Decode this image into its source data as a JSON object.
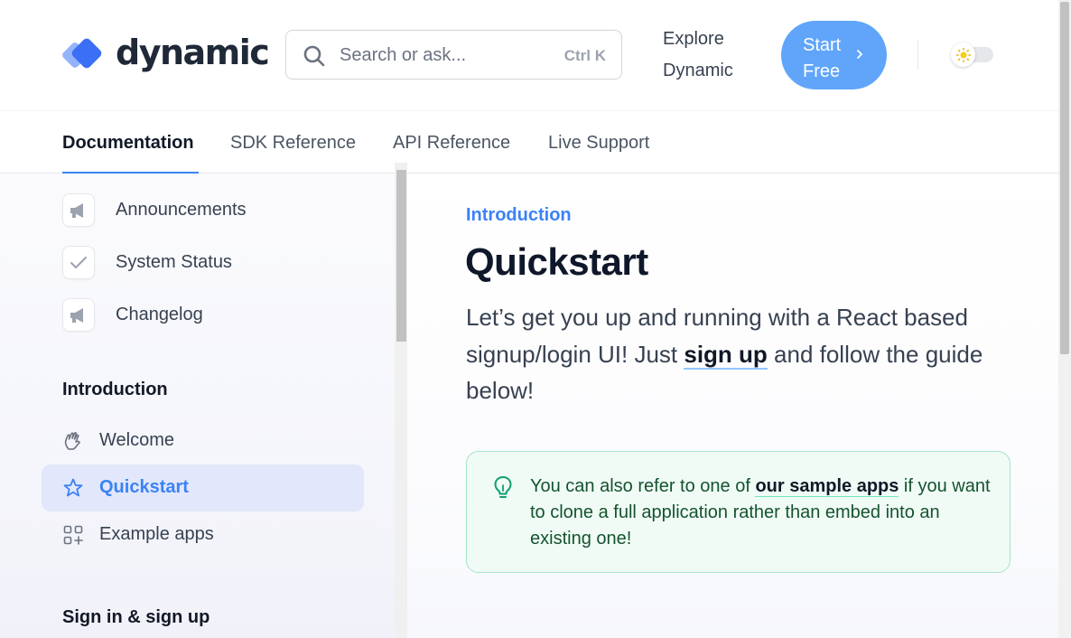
{
  "header": {
    "brand": "dynamic",
    "search_placeholder": "Search or ask...",
    "search_shortcut": "Ctrl K",
    "explore_label": "Explore Dynamic",
    "cta_label": "Start Free",
    "accent_color": "#60a5fa"
  },
  "tabs": [
    {
      "label": "Documentation",
      "active": true
    },
    {
      "label": "SDK Reference",
      "active": false
    },
    {
      "label": "API Reference",
      "active": false
    },
    {
      "label": "Live Support",
      "active": false
    }
  ],
  "sidebar": {
    "links": [
      {
        "label": "Announcements",
        "icon": "megaphone-icon"
      },
      {
        "label": "System Status",
        "icon": "check-icon"
      },
      {
        "label": "Changelog",
        "icon": "megaphone-icon"
      }
    ],
    "sections": [
      {
        "title": "Introduction",
        "items": [
          {
            "label": "Welcome",
            "icon": "waving-hand-icon",
            "active": false
          },
          {
            "label": "Quickstart",
            "icon": "star-icon",
            "active": true
          },
          {
            "label": "Example apps",
            "icon": "grid-plus-icon",
            "active": false
          }
        ]
      },
      {
        "title": "Sign in & sign up",
        "items": []
      }
    ]
  },
  "main": {
    "eyebrow": "Introduction",
    "title": "Quickstart",
    "lead_before": "Let’s get you up and running with a React based signup/login UI! Just ",
    "lead_link": "sign up",
    "lead_after": " and follow the guide below!",
    "callout_before": "You can also refer to one of ",
    "callout_link": "our sample apps",
    "callout_after": " if you want to clone a full application rather than embed into an existing one!"
  }
}
